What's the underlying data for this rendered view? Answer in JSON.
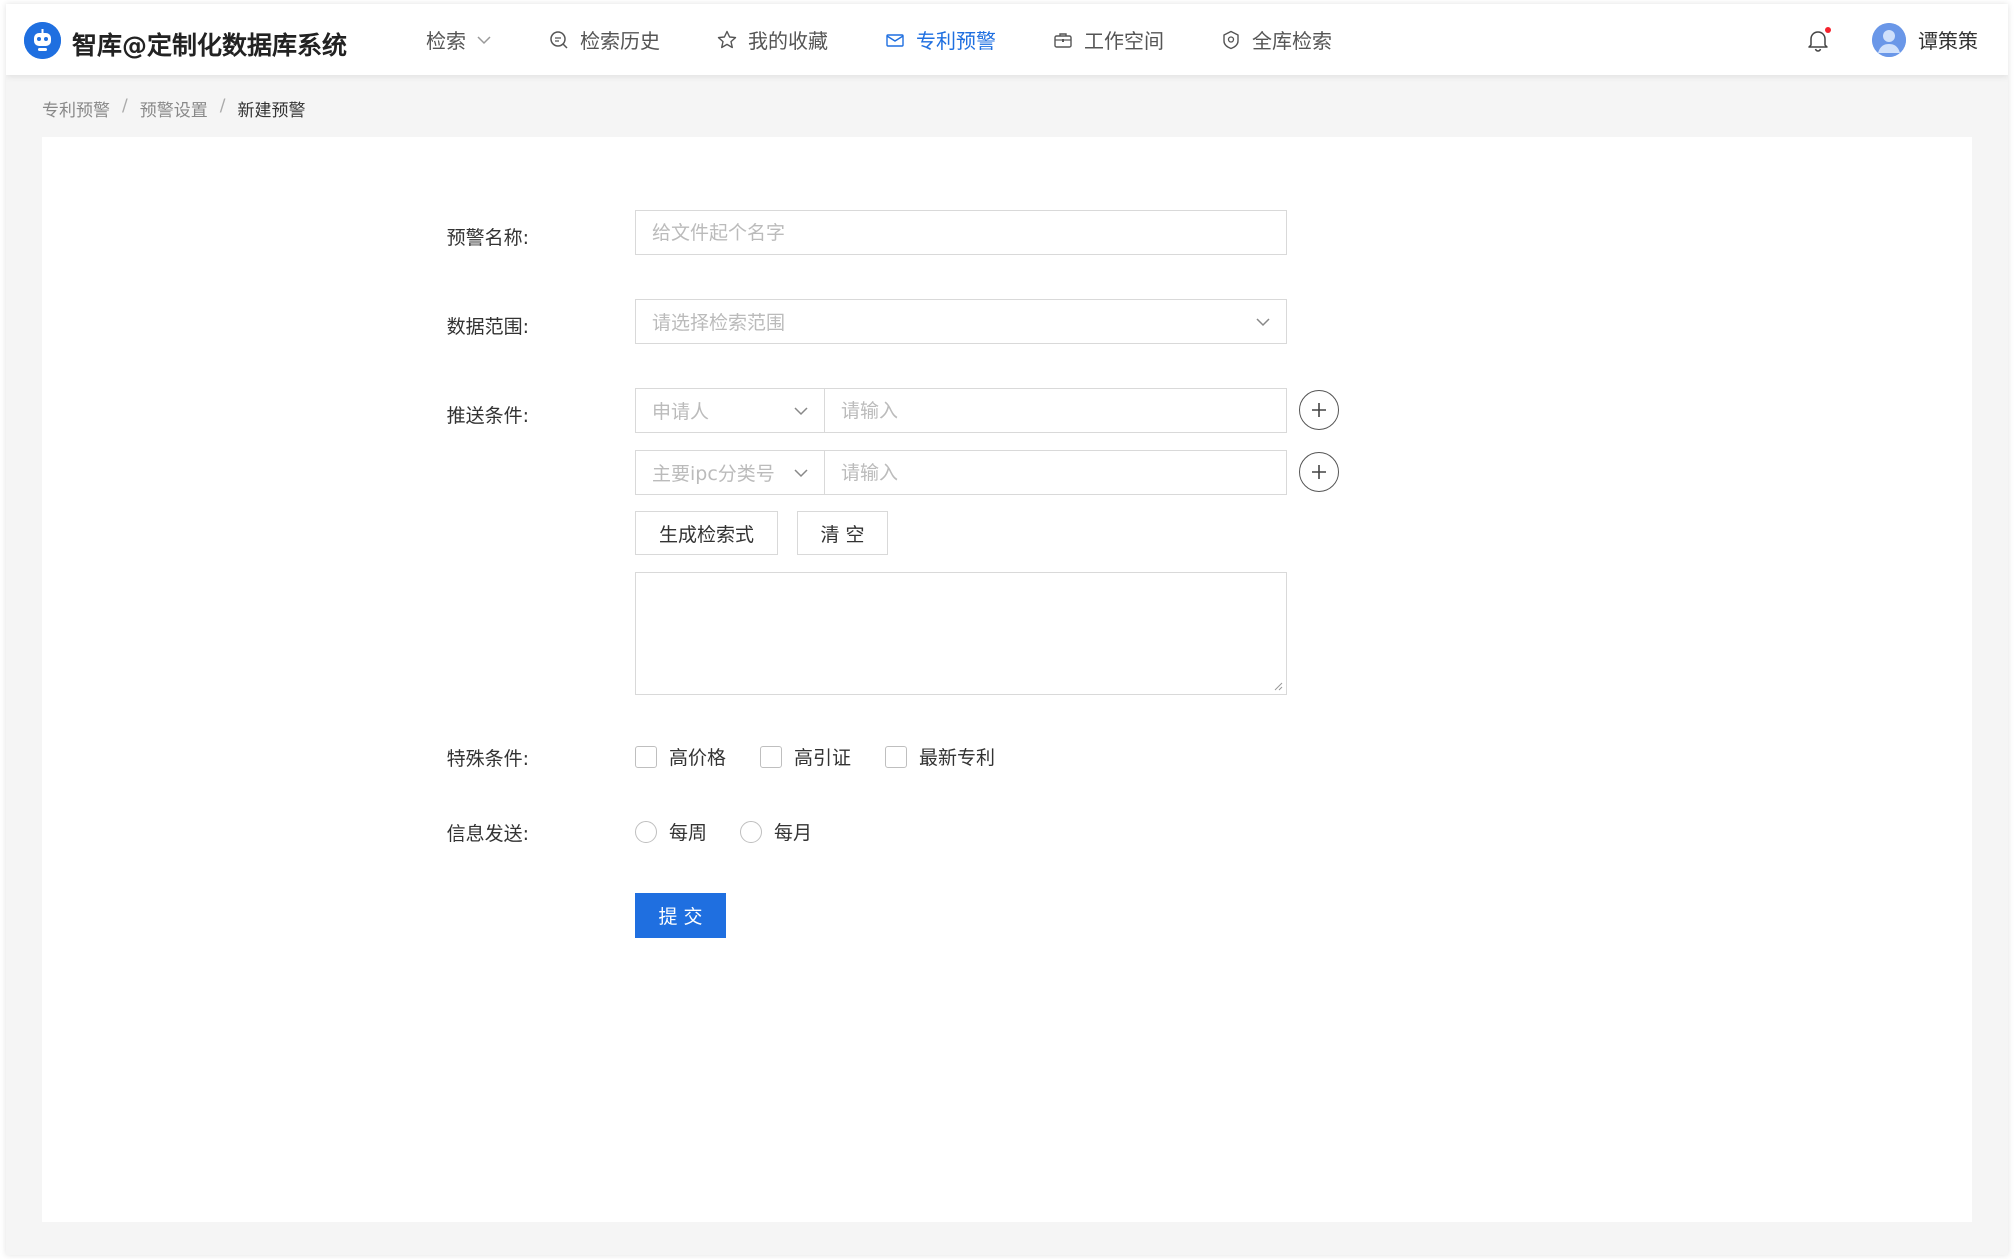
{
  "app": {
    "title": "智库@定制化数据库系统",
    "logo_icon": "robot-logo-icon",
    "accent": "#1f6fe0"
  },
  "nav": {
    "items": [
      {
        "label": "检索",
        "icon": "chevron-down-icon",
        "active": false
      },
      {
        "label": "检索历史",
        "icon": "history-icon",
        "active": false
      },
      {
        "label": "我的收藏",
        "icon": "star-icon",
        "active": false
      },
      {
        "label": "专利预警",
        "icon": "mail-alert-icon",
        "active": true
      },
      {
        "label": "工作空间",
        "icon": "briefcase-icon",
        "active": false
      },
      {
        "label": "全库检索",
        "icon": "shield-icon",
        "active": false
      }
    ]
  },
  "user": {
    "name": "谭策策",
    "notification_icon": "bell-icon",
    "has_unread": true
  },
  "breadcrumb": {
    "items": [
      "专利预警",
      "预警设置",
      "新建预警"
    ],
    "separator": "/"
  },
  "form": {
    "name": {
      "label": "预警名称:",
      "placeholder": "给文件起个名字"
    },
    "scope": {
      "label": "数据范围:",
      "placeholder": "请选择检索范围"
    },
    "conditions": {
      "label": "推送条件:",
      "rows": [
        {
          "field": "申请人",
          "placeholder": "请输入"
        },
        {
          "field": "主要ipc分类号",
          "placeholder": "请输入"
        }
      ],
      "generate_label": "生成检索式",
      "clear_label": "清 空"
    },
    "special": {
      "label": "特殊条件:",
      "options": [
        "高价格",
        "高引证",
        "最新专利"
      ]
    },
    "frequency": {
      "label": "信息发送:",
      "options": [
        "每周",
        "每月"
      ]
    },
    "submit_label": "提 交"
  }
}
